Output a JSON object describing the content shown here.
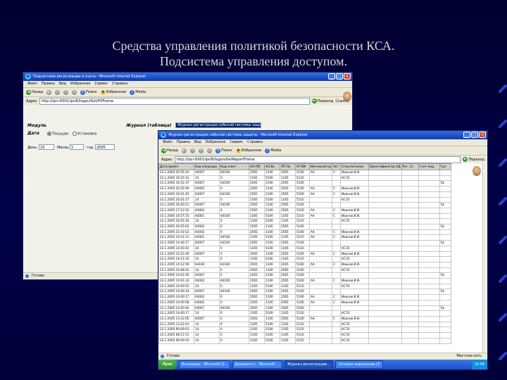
{
  "slide": {
    "title_line1": "Средства управления политикой безопасности КСА.",
    "title_line2": "Подсистема управления доступом."
  },
  "window1": {
    "title": "Подсистема регистрации и учета - Microsoft Internet Explorer",
    "menu": [
      "Файл",
      "Правка",
      "Вид",
      "Избранное",
      "Сервис",
      "Справка"
    ],
    "toolbar": {
      "back": "Назад",
      "search": "Поиск",
      "favorites": "Избранное",
      "media": "Media"
    },
    "address_label": "Адрес",
    "address": "http://ipcr:6001/ipc8i/logon/Get/PSFrame",
    "go": "Переход",
    "links": "Ссылки",
    "form": {
      "module_label": "Модуль",
      "date_label": "Дата",
      "radio_today": "Текущая",
      "radio_custom": "Установка",
      "day_label": "День",
      "day_value": "23",
      "month_label": "Месяц",
      "month_value": "1",
      "year_label": "год",
      "year_value": "2005",
      "journal_label": "Журнал (таблица)",
      "journal_value": "Журнал регистрации событий системы защиты"
    },
    "status": "Готово"
  },
  "window2": {
    "title": "Журнал регистрации событий системы защиты - Microsoft Internet Explorer",
    "menu": [
      "Файл",
      "Правка",
      "Вид",
      "Избранное",
      "Сервис",
      "Справка"
    ],
    "toolbar": {
      "back": "Назад",
      "search": "Поиск",
      "favorites": "Избранное",
      "media": "Media"
    },
    "address_label": "Адрес",
    "address": "http://ipcr:6001/ipc8i/logon/GetReportFrame",
    "go": "Переход",
    "columns": [
      "Дата-время",
      "Код операции",
      "Код-ответ",
      "АО-ПМ",
      "АО-Вх",
      "ЛП-Пк",
      "АТ-ВМ",
      "Имя-монитор",
      "Акт",
      "Спец-питания",
      "Идентификатор ОД",
      "Рег. Сл",
      "Счет-мед.",
      "Грп"
    ],
    "rows": [
      [
        "23.1.2005 16:55:24",
        "64007",
        "64100",
        "2565",
        "1100",
        "2565",
        "5100",
        "АА",
        "С",
        "Иванов И.И.",
        "",
        "",
        "",
        ""
      ],
      [
        "23.1.2005 16:55:12",
        "14",
        "0",
        "1165",
        "5100",
        "1165",
        "5110",
        "",
        "",
        "КСЗЗ",
        "",
        "",
        "",
        ""
      ],
      [
        "23.1.2005 16:52:37",
        "64007",
        "64100",
        "2565",
        "1100",
        "2565",
        "5100",
        "",
        "",
        "",
        "",
        "",
        "",
        "5$"
      ],
      [
        "23.1.2005 16:25:00",
        "64002",
        "0",
        "2565",
        "1100",
        "2565",
        "5100",
        "АА",
        "С",
        "Иванов И.И.",
        "",
        "",
        "",
        ""
      ],
      [
        "23.1.2005 16:01:45",
        "64007",
        "64100",
        "2565",
        "1100",
        "2565",
        "5100",
        "АА",
        "С",
        "Иванов И.И.",
        "",
        "",
        "",
        ""
      ],
      [
        "23.1.2005 16:01:17",
        "14",
        "0",
        "1165",
        "5100",
        "1165",
        "5110",
        "",
        "",
        "КСЗЗ",
        "",
        "",
        "",
        ""
      ],
      [
        "23.1.2005 16:00:21",
        "64007",
        "64100",
        "2565",
        "1100",
        "2565",
        "5100",
        "",
        "",
        "",
        "",
        "",
        "",
        "5$"
      ],
      [
        "23.1.2005 17:12:52",
        "64002",
        "0",
        "2565",
        "1100",
        "2565",
        "5100",
        "АА",
        "С",
        "Иванов И.И.",
        "",
        "",
        "",
        ""
      ],
      [
        "23.1.2005 16:57:15",
        "64001",
        "64100",
        "1165",
        "5100",
        "1165",
        "5110",
        "АА",
        "С",
        "Иванов И.И.",
        "",
        "",
        "",
        ""
      ],
      [
        "23.1.2005 16:55:19",
        "14",
        "0",
        "1165",
        "5100",
        "1165",
        "5110",
        "",
        "",
        "КСЗЗ",
        "",
        "",
        "",
        ""
      ],
      [
        "23.1.2005 16:55:02",
        "64002",
        "0",
        "2565",
        "1100",
        "2565",
        "5100",
        "",
        "",
        "",
        "",
        "",
        "",
        "5$"
      ],
      [
        "23.1.2005 15:43:52",
        "64002",
        "0",
        "2565",
        "1100",
        "2565",
        "5100",
        "АА",
        "С",
        "Иванов И.И.",
        "",
        "",
        "",
        ""
      ],
      [
        "23.1.2005 14:41:11",
        "64001",
        "64100",
        "1165",
        "5100",
        "1165",
        "5110",
        "АА",
        "С",
        "Иванов И.И.",
        "",
        "",
        "",
        ""
      ],
      [
        "23.1.2005 14:40:17",
        "64007",
        "64100",
        "2565",
        "1100",
        "2565",
        "5100",
        "",
        "",
        "",
        "",
        "",
        "",
        "5$"
      ],
      [
        "23.1.2005 14:16:02",
        "14",
        "0",
        "1165",
        "5100",
        "1165",
        "5110",
        "",
        "",
        "КСЗЗ",
        "",
        "",
        "",
        ""
      ],
      [
        "23.1.2005 14:15:49",
        "64007",
        "0",
        "2565",
        "1100",
        "2565",
        "5100",
        "АА",
        "С",
        "Иванов И.И.",
        "",
        "",
        "",
        ""
      ],
      [
        "23.1.2005 14:15:35",
        "14",
        "0",
        "1165",
        "5100",
        "1165",
        "5110",
        "",
        "",
        "КСЗЗ",
        "",
        "",
        "",
        ""
      ],
      [
        "23.1.2005 14:12:59",
        "64100",
        "64100",
        "2565",
        "1100",
        "2565",
        "5100",
        "АА",
        "С",
        "Иванов И.И.",
        "",
        "",
        "",
        ""
      ],
      [
        "23.1.2005 14:08:02",
        "14",
        "0",
        "2565",
        "1100",
        "2565",
        "5100",
        "",
        "",
        "КСЗЗ",
        "",
        "",
        "",
        ""
      ],
      [
        "23.1.2005 14:02:56",
        "64007",
        "0",
        "2565",
        "1100",
        "2565",
        "5100",
        "",
        "",
        "",
        "",
        "",
        "",
        "5$"
      ],
      [
        "23.1.2005 14:01:33",
        "64002",
        "64100",
        "2565",
        "1100",
        "2565",
        "5100",
        "АА",
        "С",
        "Иванов И.И.",
        "",
        "",
        "",
        ""
      ],
      [
        "23.1.2005 14:00:52",
        "14",
        "0",
        "1165",
        "5100",
        "1165",
        "5110",
        "",
        "",
        "КСЗЗ",
        "",
        "",
        "",
        ""
      ],
      [
        "23.1.2005 14:00:33",
        "64007",
        "64100",
        "2565",
        "1100",
        "2565",
        "5100",
        "",
        "",
        "",
        "",
        "",
        "",
        "5$"
      ],
      [
        "23.1.2005 14:00:17",
        "64002",
        "0",
        "2565",
        "1100",
        "2565",
        "5100",
        "АА",
        "С",
        "Иванов И.И.",
        "",
        "",
        "",
        ""
      ],
      [
        "23.1.2005 14:00:58",
        "64002",
        "0",
        "2565",
        "1100",
        "2565",
        "5100",
        "АА",
        "С",
        "Иванов И.И.",
        "",
        "",
        "",
        ""
      ],
      [
        "23.1.2005 14:00:42",
        "64007",
        "64100",
        "2565",
        "1100",
        "2565",
        "5100",
        "",
        "",
        "",
        "",
        "",
        "",
        "5$"
      ],
      [
        "23.1.2005 14:00:17",
        "14",
        "0",
        "1165",
        "5100",
        "1165",
        "5110",
        "",
        "",
        "КСЗЗ",
        "",
        "",
        "",
        ""
      ],
      [
        "23.1.2005 13:22:05",
        "64007",
        "0",
        "2565",
        "1100",
        "2565",
        "5100",
        "АА",
        "С",
        "Иванов И.И.",
        "",
        "",
        "",
        ""
      ],
      [
        "23.1.2005 13:22:01",
        "14",
        "0",
        "1165",
        "5100",
        "1165",
        "5110",
        "",
        "",
        "КСЗЗ",
        "",
        "",
        "",
        ""
      ],
      [
        "23.1.2005 09:00:03",
        "14",
        "0",
        "1165",
        "5100",
        "1165",
        "5110",
        "",
        "",
        "КСЗЗ",
        "",
        "",
        "",
        ""
      ],
      [
        "23.1.2005 08:11:51",
        "14",
        "0",
        "1165",
        "5100",
        "1165",
        "5110",
        "",
        "",
        "КСЗЗ",
        "",
        "",
        "",
        ""
      ],
      [
        "23.1.2005 09:00:03",
        "14",
        "0",
        "1165",
        "5100",
        "1165",
        "5110",
        "",
        "",
        "КСЗЗ",
        "",
        "",
        "",
        ""
      ]
    ],
    "status": "Готово",
    "zone": "Местная сеть"
  },
  "taskbar": {
    "start": "Пуск",
    "items": [
      "Входящие - Microsoft O...",
      "Документ1 - Microsoft ...",
      "Журнал регистрации...",
      "Сетевое окружение LF"
    ],
    "clock": "16:58"
  }
}
